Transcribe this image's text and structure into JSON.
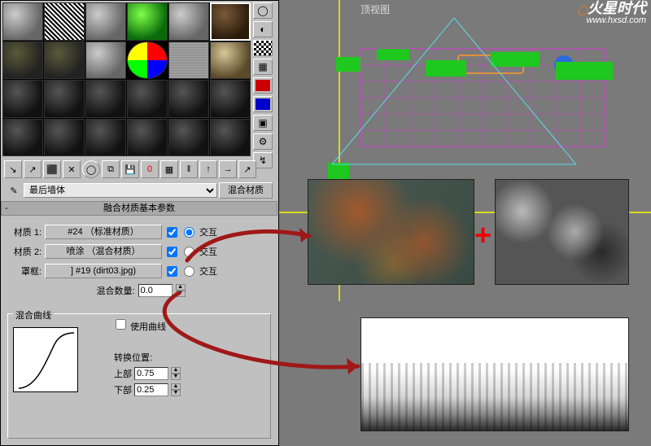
{
  "viewport": {
    "label": "顶视图"
  },
  "watermark": {
    "brand": "火星时代",
    "url": "www.hxsd.com"
  },
  "material_name": "最后墙体",
  "type_button": "混合材质",
  "rollout_title": "融合材质基本参数",
  "rows": {
    "mat1": {
      "label": "材质 1:",
      "button": "#24  （标准材质）",
      "checked": true,
      "radio_label": "交互",
      "radio_sel": true
    },
    "mat2": {
      "label": "材质 2:",
      "button": "喷涂  （混合材质）",
      "checked": true,
      "radio_label": "交互",
      "radio_sel": false
    },
    "mask": {
      "label": "罩框:",
      "button": "] #19 (dirt03.jpg)",
      "checked": true,
      "radio_label": "交互",
      "radio_sel": false
    }
  },
  "mix": {
    "label": "混合数量:",
    "value": "0.0"
  },
  "curve": {
    "group": "混合曲线",
    "use_curve": "使用曲线",
    "use_curve_checked": false,
    "transition": "转换位置:",
    "upper_label": "上部",
    "upper_value": "0.75",
    "lower_label": "下部",
    "lower_value": "0.25"
  },
  "side_icons": [
    "sample-type",
    "backlight",
    "background",
    "uv-tile",
    "color-check",
    "video-check",
    "options",
    "material-map",
    "root"
  ],
  "toolbar_icons": [
    "get",
    "put",
    "assign",
    "reset",
    "clone",
    "put-lib",
    "mat-effects",
    "show-map",
    "show-end",
    "nav-parent",
    "nav-sibling",
    "nav-child",
    "pick"
  ]
}
